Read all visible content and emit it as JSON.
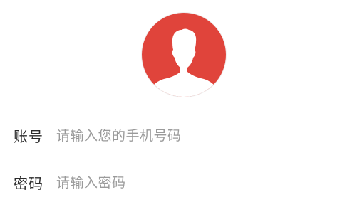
{
  "avatar": {
    "icon": "user-avatar-icon",
    "background_color": "#e0443b",
    "silhouette_color": "#ffffff"
  },
  "form": {
    "account": {
      "label": "账号",
      "placeholder": "请输入您的手机号码",
      "value": ""
    },
    "password": {
      "label": "密码",
      "placeholder": "请输入密码",
      "value": ""
    }
  }
}
